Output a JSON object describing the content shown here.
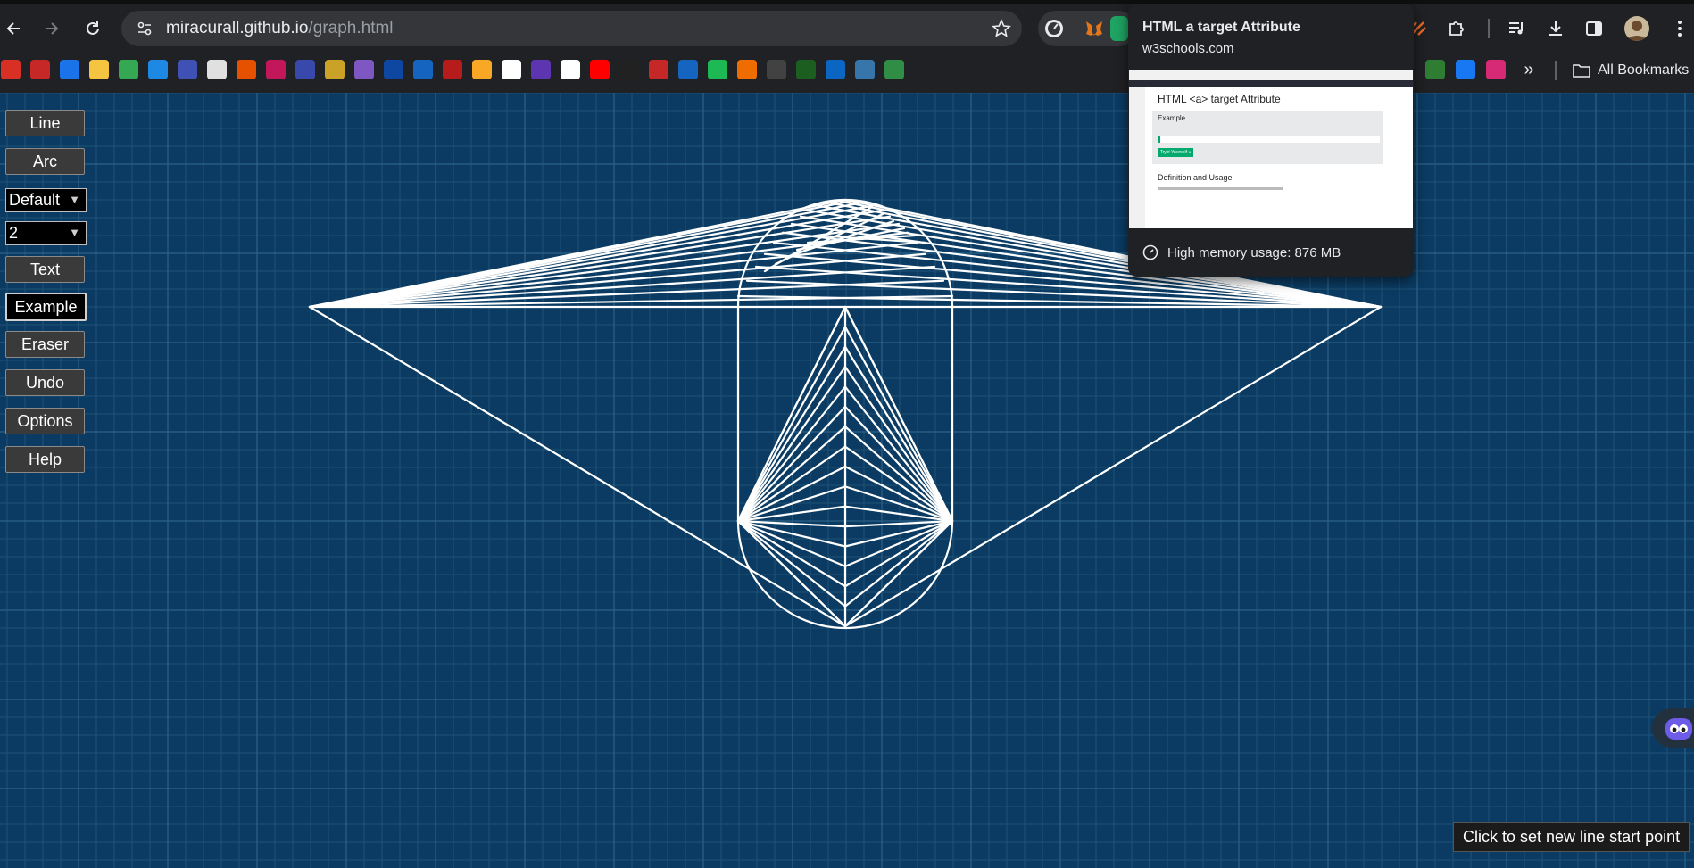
{
  "browser": {
    "url_host": "miracurall.github.io",
    "url_path": "/graph.html",
    "all_bookmarks_label": "All Bookmarks",
    "bookmark_icons": [
      "gmail-icon",
      "shield-icon",
      "amazon-icon",
      "mail-icon",
      "drive-icon",
      "circle-icon",
      "bank-icon",
      "globe-icon",
      "link-icon",
      "airtel-icon",
      "crown-icon",
      "dollar-icon",
      "swirl-icon",
      "paypal-icon",
      "feather-icon",
      "book-icon",
      "flipkart-icon",
      "amazon-a-icon",
      "cube-icon",
      "google-icon",
      "youtube-icon",
      "bh-icon",
      "h-icon",
      "play-icon",
      "spotify-icon",
      "infinity-icon",
      "github-icon",
      "hackerrank-icon",
      "linkedin-icon",
      "python-icon",
      "gfg-icon",
      "w-icon",
      "facebook-icon",
      "instagram-icon"
    ]
  },
  "hover_card": {
    "title": "HTML a target Attribute",
    "domain": "w3schools.com",
    "memory": "High memory usage: 876 MB",
    "thumb_heading": "HTML <a> target Attribute",
    "thumb_example": "Example",
    "thumb_def": "Definition and Usage",
    "thumb_button": "Try it Yourself »"
  },
  "toolbar": {
    "line": "Line",
    "arc": "Arc",
    "style_select": "Default",
    "width_select": "2",
    "text": "Text",
    "example": "Example",
    "eraser": "Eraser",
    "undo": "Undo",
    "options": "Options",
    "help": "Help"
  },
  "status": "Click to set new line start point",
  "colors": {
    "canvas_bg": "#0b3b62",
    "grid_minor": "#1f5177",
    "grid_major": "#2d6287",
    "drawing": "#ffffff"
  }
}
